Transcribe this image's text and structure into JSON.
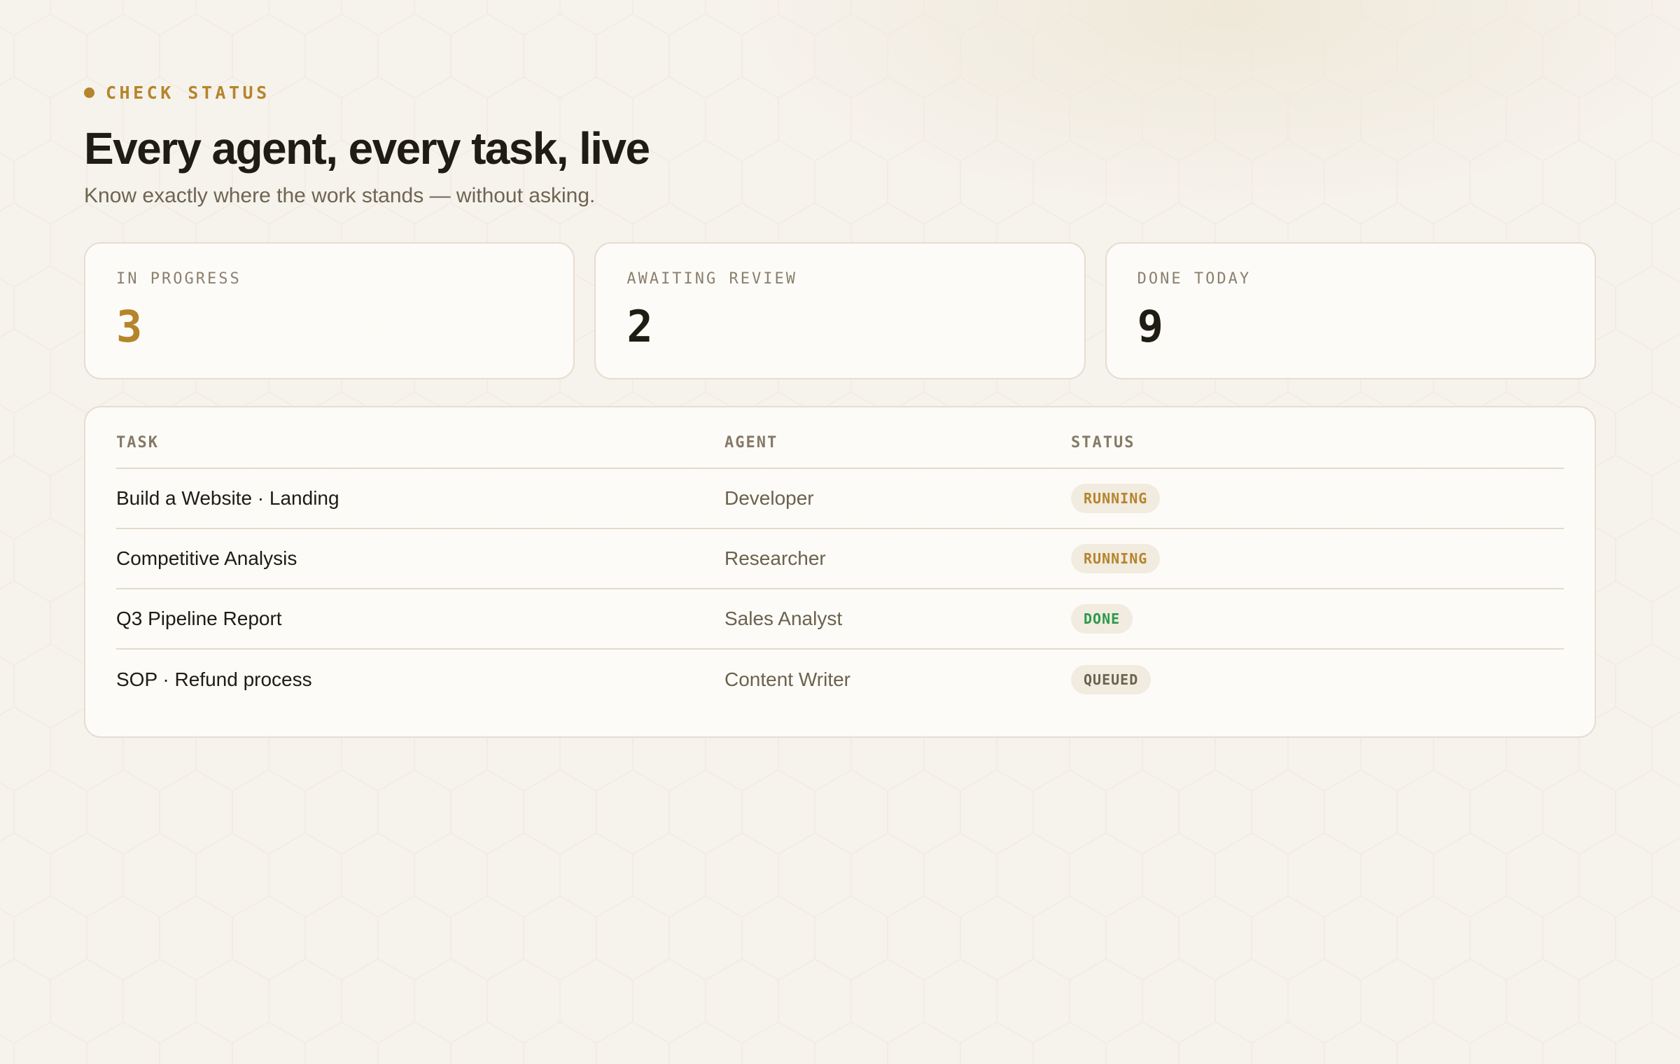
{
  "header": {
    "eyebrow": "CHECK STATUS",
    "title": "Every agent, every task, live",
    "subtitle": "Know exactly where the work stands — without asking."
  },
  "stats": [
    {
      "label": "IN PROGRESS",
      "value": "3"
    },
    {
      "label": "AWAITING REVIEW",
      "value": "2"
    },
    {
      "label": "DONE TODAY",
      "value": "9"
    }
  ],
  "table": {
    "columns": [
      "TASK",
      "AGENT",
      "STATUS"
    ],
    "rows": [
      {
        "task": "Build a Website · Landing",
        "agent": "Developer",
        "status": "RUNNING"
      },
      {
        "task": "Competitive Analysis",
        "agent": "Researcher",
        "status": "RUNNING"
      },
      {
        "task": "Q3 Pipeline Report",
        "agent": "Sales Analyst",
        "status": "DONE"
      },
      {
        "task": "SOP · Refund process",
        "agent": "Content Writer",
        "status": "QUEUED"
      }
    ]
  },
  "colors": {
    "accent": "#b5852b",
    "done": "#2b9a4a",
    "background": "#f6f2ec",
    "card": "#fdfcf8",
    "text": "#1f1c14",
    "muted": "#6e6552"
  }
}
